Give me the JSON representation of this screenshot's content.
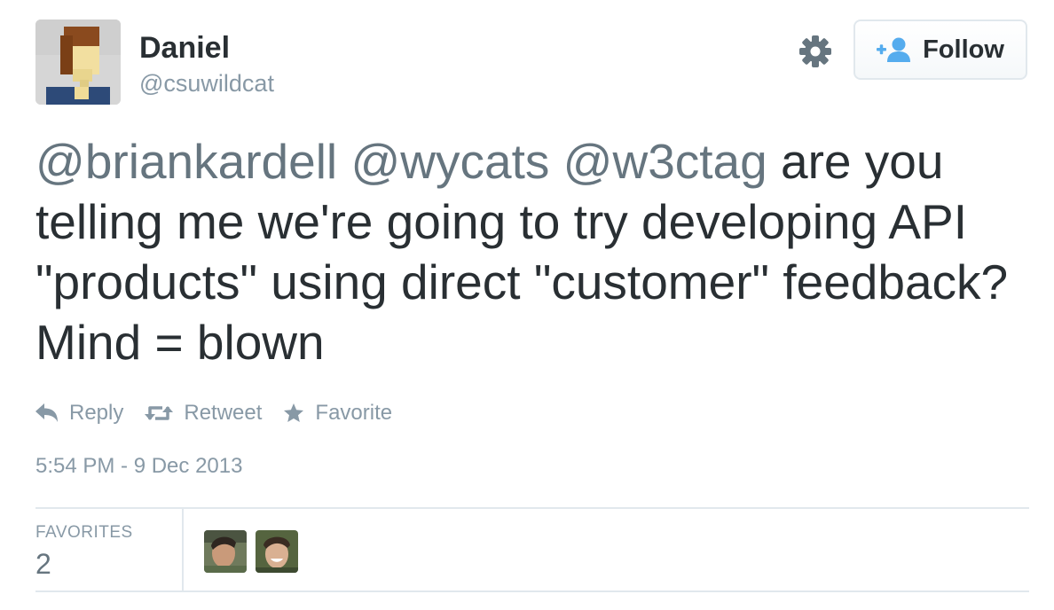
{
  "user": {
    "name": "Daniel",
    "handle": "@csuwildcat"
  },
  "follow_button": {
    "label": "Follow"
  },
  "tweet": {
    "mentions": [
      "@briankardell",
      "@wycats",
      "@w3ctag"
    ],
    "text": "are you telling me we're going to try developing API \"products\" using direct \"customer\" feedback? Mind = blown"
  },
  "actions": {
    "reply": "Reply",
    "retweet": "Retweet",
    "favorite": "Favorite"
  },
  "timestamp": "5:54 PM - 9 Dec 2013",
  "stats": {
    "favorites_label": "FAVORITES",
    "favorites_count": "2"
  },
  "icons": {
    "settings": "gear-icon",
    "follow": "add-user-icon",
    "reply": "reply-arrow-icon",
    "retweet": "retweet-icon",
    "favorite": "star-icon"
  },
  "colors": {
    "text": "#292f33",
    "mention": "#66757f",
    "muted": "#8899a6",
    "accent": "#55acee",
    "border": "#e1e8ed"
  }
}
